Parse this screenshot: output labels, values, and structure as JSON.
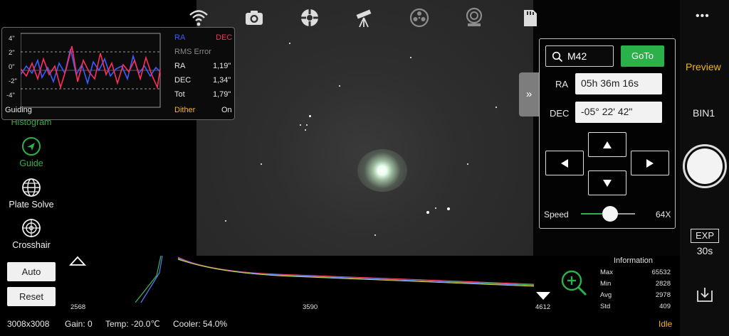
{
  "guiding": {
    "legend_ra": "RA",
    "legend_dec": "DEC",
    "rms_title": "RMS Error",
    "rows": [
      {
        "label": "RA",
        "value": "1,19\""
      },
      {
        "label": "DEC",
        "value": "1,34\""
      },
      {
        "label": "Tot",
        "value": "1,79\""
      }
    ],
    "title": "Guiding",
    "dither_label": "Dither",
    "dither_value": "On",
    "y_ticks": [
      "4\"",
      "2\"",
      "0\"",
      "-2\"",
      "-4\""
    ]
  },
  "left_menu": {
    "histogram": "Histogram",
    "guide": "Guide",
    "plate_solve": "Plate Solve",
    "crosshair": "Crosshair"
  },
  "top_icons": [
    "wifi-icon",
    "camera-icon",
    "focuser-icon",
    "telescope-icon",
    "filter-wheel-icon",
    "guide-camera-icon",
    "sd-card-icon"
  ],
  "goto": {
    "search_value": "M42",
    "goto_label": "GoTo",
    "ra_label": "RA",
    "ra_value": "05h 36m 16s",
    "dec_label": "DEC",
    "dec_value": "-05° 22' 42\"",
    "speed_label": "Speed",
    "speed_value": "64X",
    "speed_fraction": 0.55
  },
  "right_bar": {
    "more": "•••",
    "preview": "Preview",
    "bin": "BIN1",
    "exp_label": "EXP",
    "exp_value": "30s"
  },
  "histogram": {
    "auto_label": "Auto",
    "reset_label": "Reset",
    "low": "2568",
    "mid": "3590",
    "high": "4612",
    "info_title": "Information",
    "stats": [
      {
        "label": "Max",
        "value": "65532"
      },
      {
        "label": "Min",
        "value": "2828"
      },
      {
        "label": "Avg",
        "value": "2978"
      },
      {
        "label": "Std",
        "value": "409"
      }
    ]
  },
  "status": {
    "resolution": "3008x3008",
    "gain": "Gain: 0",
    "temp": "Temp: -20.0℃",
    "cooler": "Cooler: 54.0%",
    "state": "Idle"
  },
  "colors": {
    "accent_green": "#2bb14a",
    "accent_yellow": "#f0b42a",
    "ra_blue": "#3b5bff",
    "dec_red": "#ff2d5a"
  }
}
